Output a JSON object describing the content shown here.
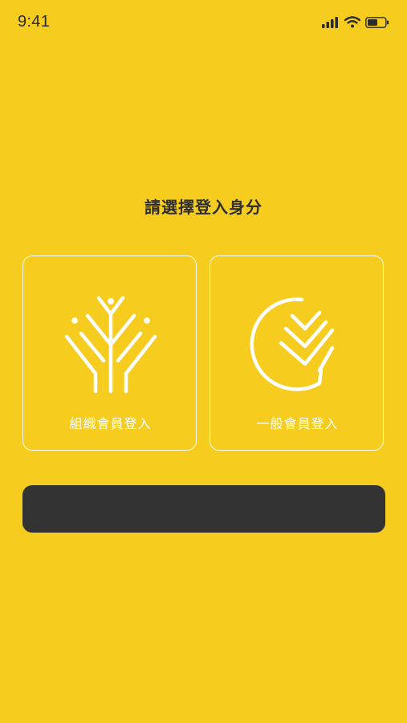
{
  "status_bar": {
    "time": "9:41"
  },
  "header": {
    "title": "請選擇登入身分"
  },
  "options": [
    {
      "id": "organization",
      "label": "組織會員登入",
      "icon": "tree-branch-icon"
    },
    {
      "id": "general",
      "label": "一般會員登入",
      "icon": "leaf-chat-icon"
    }
  ],
  "bottom_button": {
    "label": ""
  },
  "colors": {
    "background": "#F6CD1F",
    "card_border": "#FFFFFF",
    "title_text": "#2D2D2D",
    "button_bg": "#333333"
  }
}
